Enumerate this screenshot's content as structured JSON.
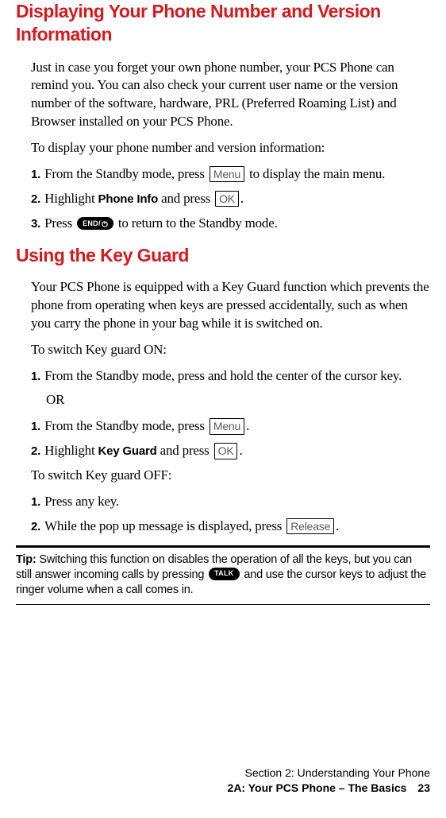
{
  "heading1": "Displaying Your Phone Number and Version Information",
  "sec1": {
    "intro": "Just in case you forget your own phone number, your PCS Phone can remind you. You can also check your current user name or the version number of the software, hardware, PRL (Preferred Roaming List) and Browser installed on your PCS Phone.",
    "lead": "To display your phone number and version information:",
    "step1_pre": "From the Standby mode, press ",
    "step1_key": "Menu",
    "step1_post": " to display the main menu.",
    "step2_pre": "Highlight ",
    "step2_bold": "Phone Info",
    "step2_mid": " and press ",
    "step2_key": "OK",
    "step2_post": ".",
    "step3_pre": "Press ",
    "step3_key": "END/",
    "step3_post": " to return to the Standby mode."
  },
  "heading2": "Using the Key Guard",
  "sec2": {
    "intro": "Your PCS Phone is equipped with a Key Guard function which prevents the phone from operating when keys are pressed accidentally, such as when you carry the phone in your bag while it is switched on.",
    "lead_on": "To switch Key guard ON:",
    "on_step1": "From the Standby mode, press and hold the center of the cursor key.",
    "or": "OR",
    "on_step1b_pre": "From the Standby mode, press ",
    "on_step1b_key": "Menu",
    "on_step1b_post": ".",
    "on_step2_pre": "Highlight ",
    "on_step2_bold": "Key Guard",
    "on_step2_mid": " and press ",
    "on_step2_key": "OK",
    "on_step2_post": ".",
    "lead_off": "To switch Key guard OFF:",
    "off_step1": "Press any key.",
    "off_step2_pre": "While the pop up message is displayed, press ",
    "off_step2_key": "Release",
    "off_step2_post": "."
  },
  "nums": {
    "n1": "1.",
    "n2": "2.",
    "n3": "3."
  },
  "tip": {
    "label": "Tip:",
    "text_pre": " Switching this function on disables the operation of all the keys, but you can still answer incoming calls by pressing ",
    "key": "TALK",
    "text_post": " and use the cursor keys to adjust the ringer volume when a call comes in."
  },
  "footer": {
    "line1": "Section 2: Understanding Your Phone",
    "line2": "2A: Your PCS Phone – The Basics",
    "page": "23"
  }
}
